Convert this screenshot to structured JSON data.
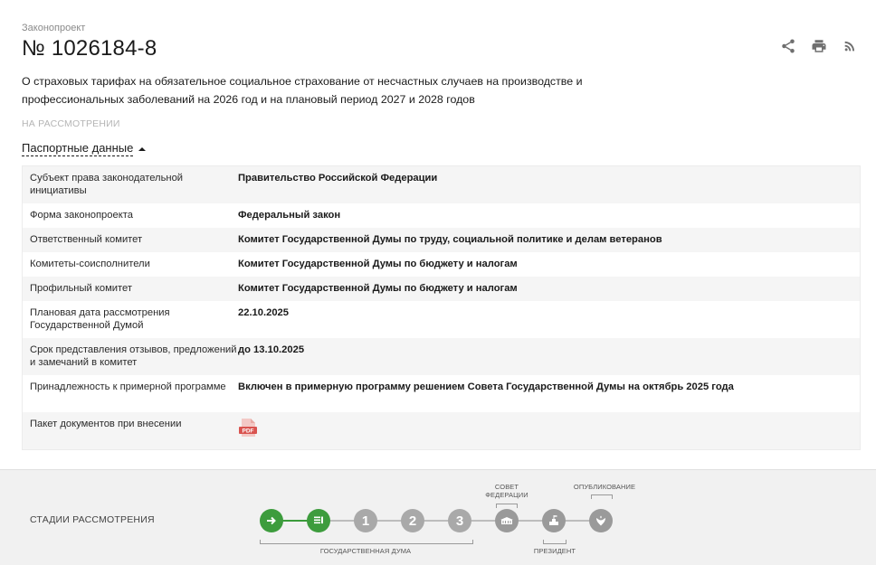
{
  "header": {
    "bill_type": "Законопроект",
    "bill_number": "№ 1026184-8",
    "title": "О страховых тарифах на обязательное социальное страхование от несчастных случаев на производстве и профессиональных заболеваний на 2026 год и на плановый период 2027 и 2028 годов",
    "status": "НА РАССМОТРЕНИИ"
  },
  "actions": {
    "icons": [
      "share-icon",
      "print-icon",
      "rss-icon"
    ]
  },
  "passport": {
    "toggle_label": "Паспортные данные",
    "rows": [
      {
        "label": "Субъект права законодательной инициативы",
        "value": "Правительство Российской Федерации"
      },
      {
        "label": "Форма законопроекта",
        "value": "Федеральный закон"
      },
      {
        "label": "Ответственный комитет",
        "value": "Комитет Государственной Думы по труду, социальной политике и делам ветеранов"
      },
      {
        "label": "Комитеты-соисполнители",
        "value": "Комитет Государственной Думы по бюджету и налогам"
      },
      {
        "label": "Профильный комитет",
        "value": "Комитет Государственной Думы по бюджету и налогам"
      },
      {
        "label": "Плановая дата рассмотрения Государственной Думой",
        "value": "22.10.2025"
      },
      {
        "label": "Срок представления отзывов, предложений и замечаний в комитет",
        "value": "до 13.10.2025"
      },
      {
        "label": "Принадлежность к примерной программе",
        "value": "Включен в примерную программу решением Совета Государственной Думы на октябрь 2025 года"
      },
      {
        "label": "Пакет документов при внесении",
        "value": ""
      }
    ],
    "pdf_icon_text": "PDF"
  },
  "stages": {
    "label": "СТАДИИ РАССМОТРЕНИЯ",
    "nodes": [
      "→",
      "≡",
      "1",
      "2",
      "3",
      "",
      "",
      ""
    ],
    "captions": {
      "federation_council": "СОВЕТ ФЕДЕРАЦИИ",
      "publication": "ОПУБЛИКОВАНИЕ",
      "state_duma": "ГОСУДАРСТВЕННАЯ ДУМА",
      "president": "ПРЕЗИДЕНТ"
    },
    "colors": {
      "done": "#3d9c3d",
      "pending": "#a9a9a9"
    }
  }
}
